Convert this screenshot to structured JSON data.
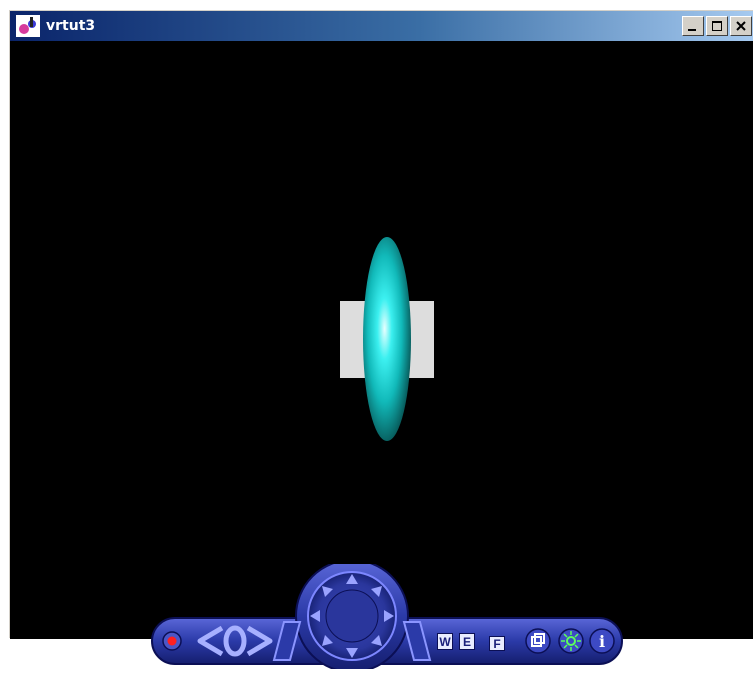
{
  "window": {
    "title": "vrtut3",
    "controls": [
      "minimize",
      "maximize",
      "close"
    ]
  },
  "scene": {
    "background": "#000000",
    "objects": [
      {
        "name": "cyan-ellipsoid",
        "color": "#19e6e6"
      },
      {
        "name": "left-gray-block",
        "color": "#dddddd"
      },
      {
        "name": "right-gray-block",
        "color": "#dddddd"
      }
    ]
  },
  "navbar": {
    "mode_buttons": {
      "walk": "W",
      "examine": "E",
      "fly": "F"
    },
    "icons": [
      "record-icon",
      "back-icon",
      "home-icon",
      "forward-icon",
      "navigation-wheel",
      "viewpoint-icon",
      "headlight-icon",
      "info-icon"
    ],
    "accent": "#2b3aa8"
  }
}
